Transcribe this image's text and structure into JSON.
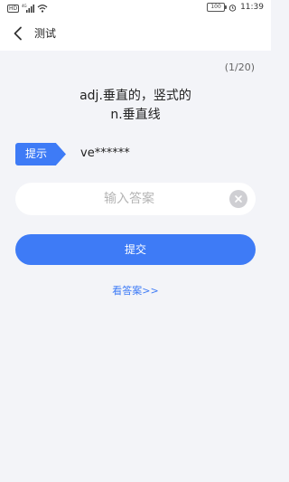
{
  "status_bar": {
    "hd": "HD",
    "network": "4G",
    "battery": "100",
    "time": "11:39"
  },
  "nav": {
    "title": "测试"
  },
  "quiz": {
    "progress": "(1/20)",
    "definition_line1": "adj.垂直的，竖式的",
    "definition_line2": "n.垂直线",
    "hint_label": "提示",
    "hint_value": "ve******",
    "answer_placeholder": "输入答案",
    "answer_value": "",
    "submit_label": "提交",
    "view_answer_label": "看答案>>"
  },
  "colors": {
    "accent": "#3E7BF6",
    "background": "#F3F4F8"
  },
  "icons": {
    "back": "chevron-left-icon",
    "clear": "clear-circle-icon",
    "wifi": "wifi-icon",
    "signal": "signal-icon",
    "alarm": "alarm-icon"
  }
}
